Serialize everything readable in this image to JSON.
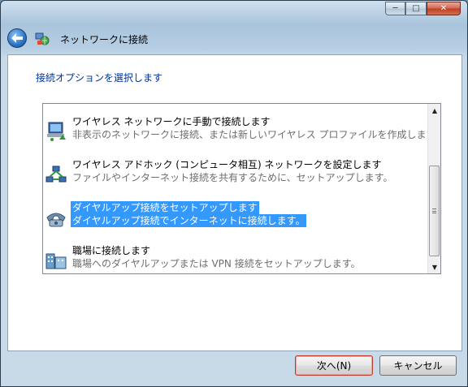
{
  "window": {
    "title": "ネットワークに接続",
    "caption_buttons": {
      "minimize": "─",
      "maximize": "□",
      "close": "✕"
    }
  },
  "main": {
    "instruction": "接続オプションを選択します",
    "options": [
      {
        "title": "ワイヤレス ネットワークに手動で接続します",
        "description": "非表示のネットワークに接続、または新しいワイヤレス プロファイルを作成します。",
        "icon": "wireless-network-icon",
        "selected": false
      },
      {
        "title": "ワイヤレス アドホック (コンピュータ相互) ネットワークを設定します",
        "description": "ファイルやインターネット接続を共有するために、セットアップします。",
        "icon": "adhoc-network-icon",
        "selected": false
      },
      {
        "title": "ダイヤルアップ接続をセットアップします",
        "description": "ダイヤルアップ接続でインターネットに接続します。",
        "icon": "phone-icon",
        "selected": true
      },
      {
        "title": "職場に接続します",
        "description": "職場へのダイヤルアップまたは VPN 接続をセットアップします。",
        "icon": "workplace-icon",
        "selected": false
      }
    ]
  },
  "footer": {
    "next_label": "次へ(N)",
    "cancel_label": "キャンセル"
  },
  "colors": {
    "selection": "#3399ff",
    "instruction": "#003399",
    "default_button_border": "#c0392b"
  }
}
